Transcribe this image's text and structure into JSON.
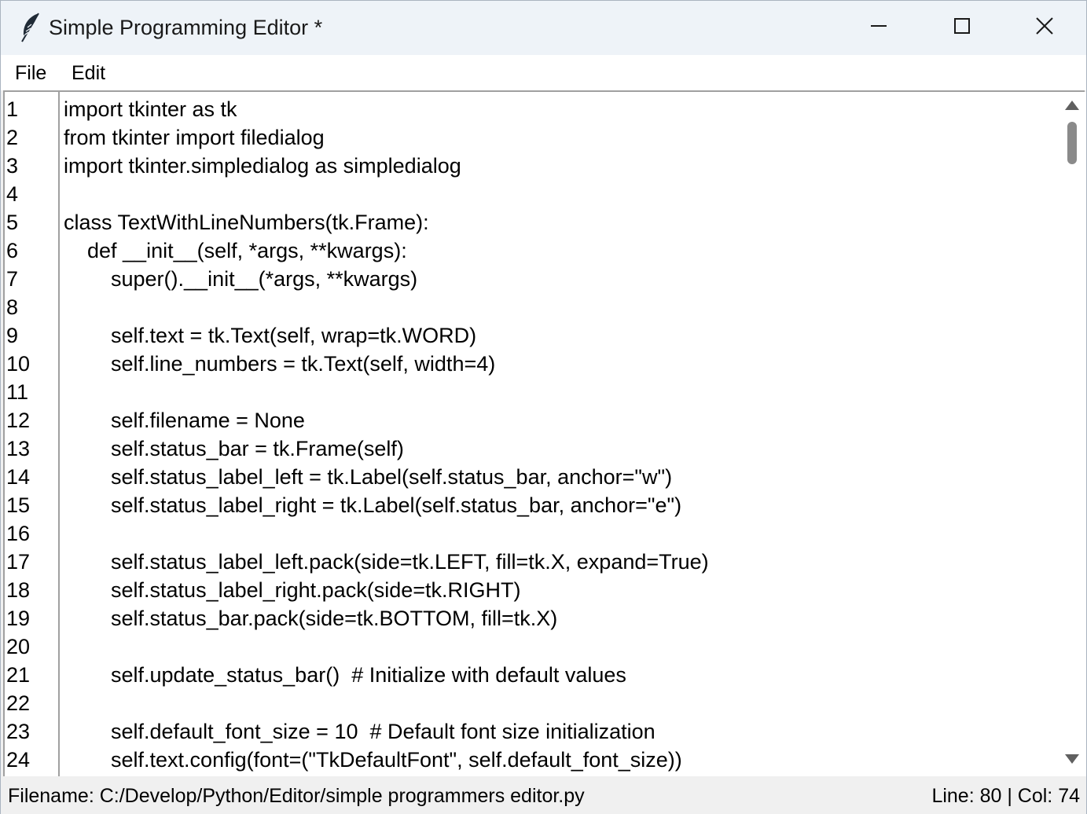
{
  "window": {
    "title": "Simple Programming Editor *",
    "icons": {
      "app": "feather-icon",
      "minimize": "minimize-icon",
      "maximize": "maximize-icon",
      "close": "close-icon"
    }
  },
  "menu": {
    "file": "File",
    "edit": "Edit"
  },
  "editor": {
    "line_numbers": [
      "1",
      "2",
      "3",
      "4",
      "5",
      "6",
      "7",
      "8",
      "9",
      "10",
      "11",
      "12",
      "13",
      "14",
      "15",
      "16",
      "17",
      "18",
      "19",
      "20",
      "21",
      "22",
      "23",
      "24"
    ],
    "lines": [
      "import tkinter as tk",
      "from tkinter import filedialog",
      "import tkinter.simpledialog as simpledialog",
      "",
      "class TextWithLineNumbers(tk.Frame):",
      "    def __init__(self, *args, **kwargs):",
      "        super().__init__(*args, **kwargs)",
      "",
      "        self.text = tk.Text(self, wrap=tk.WORD)",
      "        self.line_numbers = tk.Text(self, width=4)",
      "",
      "        self.filename = None",
      "        self.status_bar = tk.Frame(self)",
      "        self.status_label_left = tk.Label(self.status_bar, anchor=\"w\")",
      "        self.status_label_right = tk.Label(self.status_bar, anchor=\"e\")",
      "",
      "        self.status_label_left.pack(side=tk.LEFT, fill=tk.X, expand=True)",
      "        self.status_label_right.pack(side=tk.RIGHT)",
      "        self.status_bar.pack(side=tk.BOTTOM, fill=tk.X)",
      "",
      "        self.update_status_bar()  # Initialize with default values",
      "",
      "        self.default_font_size = 10  # Default font size initialization",
      "        self.text.config(font=(\"TkDefaultFont\", self.default_font_size))"
    ],
    "scroll_position": 0.0
  },
  "status": {
    "left": "Filename: C:/Develop/Python/Editor/simple programmers editor.py",
    "right": "Line: 80 | Col: 74"
  },
  "colors": {
    "titlebar": "#eef3f8",
    "border": "#a0a0a0",
    "background": "#f0f0f0"
  }
}
